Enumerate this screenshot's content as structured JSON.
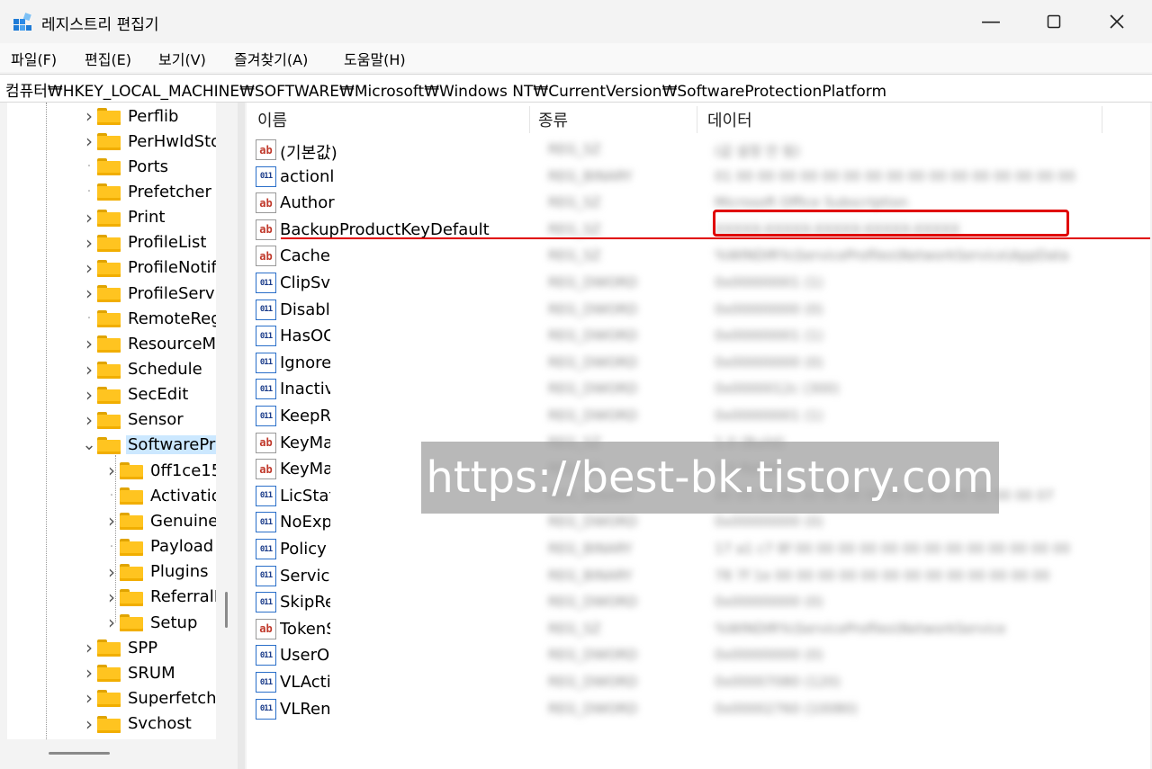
{
  "window": {
    "title": "레지스트리 편집기"
  },
  "menu": [
    "파일(F)",
    "편집(E)",
    "보기(V)",
    "즐겨찾기(A)",
    "도움말(H)"
  ],
  "address": "컴퓨터₩HKEY_LOCAL_MACHINE₩SOFTWARE₩Microsoft₩Windows NT₩CurrentVersion₩SoftwareProtectionPlatform",
  "tree": [
    {
      "label": "Perflib",
      "level": 0,
      "expand": "collapsed"
    },
    {
      "label": "PerHwIdSto",
      "level": 0,
      "expand": "collapsed"
    },
    {
      "label": "Ports",
      "level": 0,
      "expand": "none"
    },
    {
      "label": "Prefetcher",
      "level": 0,
      "expand": "none"
    },
    {
      "label": "Print",
      "level": 0,
      "expand": "collapsed"
    },
    {
      "label": "ProfileList",
      "level": 0,
      "expand": "collapsed"
    },
    {
      "label": "ProfileNotif",
      "level": 0,
      "expand": "collapsed"
    },
    {
      "label": "ProfileServi",
      "level": 0,
      "expand": "collapsed"
    },
    {
      "label": "RemoteReg",
      "level": 0,
      "expand": "none"
    },
    {
      "label": "ResourceM",
      "level": 0,
      "expand": "collapsed"
    },
    {
      "label": "Schedule",
      "level": 0,
      "expand": "collapsed"
    },
    {
      "label": "SecEdit",
      "level": 0,
      "expand": "collapsed"
    },
    {
      "label": "Sensor",
      "level": 0,
      "expand": "collapsed"
    },
    {
      "label": "SoftwarePr",
      "level": 0,
      "expand": "expanded",
      "selected": true
    },
    {
      "label": "0ff1ce15",
      "level": 1,
      "expand": "collapsed"
    },
    {
      "label": "Activatio",
      "level": 1,
      "expand": "none"
    },
    {
      "label": "Genuine",
      "level": 1,
      "expand": "collapsed"
    },
    {
      "label": "Payload",
      "level": 1,
      "expand": "none"
    },
    {
      "label": "Plugins",
      "level": 1,
      "expand": "collapsed"
    },
    {
      "label": "ReferralD",
      "level": 1,
      "expand": "collapsed"
    },
    {
      "label": "Setup",
      "level": 1,
      "expand": "collapsed"
    },
    {
      "label": "SPP",
      "level": 0,
      "expand": "collapsed"
    },
    {
      "label": "SRUM",
      "level": 0,
      "expand": "collapsed"
    },
    {
      "label": "Superfetch",
      "level": 0,
      "expand": "collapsed"
    },
    {
      "label": "Svchost",
      "level": 0,
      "expand": "collapsed"
    }
  ],
  "columns": {
    "name": "이름",
    "type": "종류",
    "data": "데이터"
  },
  "values": [
    {
      "name": "(기본값)",
      "kind": "sz",
      "type": "REG_SZ",
      "data": "(값 설정 안 됨)"
    },
    {
      "name": "actionli",
      "kind": "dword",
      "type": "REG_BINARY",
      "data": "01 00 00 00 00 00 00 00 00 00 00 00 00 00 00 00 00"
    },
    {
      "name": "Author",
      "kind": "sz",
      "type": "REG_SZ",
      "data": "Microsoft Office Subscription"
    },
    {
      "name": "BackupProductKeyDefault",
      "kind": "sz",
      "type": "REG_SZ",
      "data": "XXXXX-XXXXX-XXXXX-XXXXX-XXXXX"
    },
    {
      "name": "Cache",
      "kind": "sz",
      "type": "REG_SZ",
      "data": "%WINDIR%\\ServiceProfiles\\NetworkService\\AppData"
    },
    {
      "name": "ClipSv",
      "kind": "dword",
      "type": "REG_DWORD",
      "data": "0x00000001 (1)"
    },
    {
      "name": "Disable",
      "kind": "dword",
      "type": "REG_DWORD",
      "data": "0x00000000 (0)"
    },
    {
      "name": "HasOC",
      "kind": "dword",
      "type": "REG_DWORD",
      "data": "0x00000001 (1)"
    },
    {
      "name": "Ignore",
      "kind": "dword",
      "type": "REG_DWORD",
      "data": "0x00000000 (0)"
    },
    {
      "name": "Inactiv",
      "kind": "dword",
      "type": "REG_DWORD",
      "data": "0x0000012c (300)"
    },
    {
      "name": "KeepR",
      "kind": "dword",
      "type": "REG_DWORD",
      "data": "0x00000001 (1)"
    },
    {
      "name": "KeyMa",
      "kind": "sz",
      "type": "REG_SZ",
      "data": "1.0 (Build)"
    },
    {
      "name": "KeyMa",
      "kind": "sz",
      "type": "REG_SZ",
      "data": "3.0 Retail"
    },
    {
      "name": "LicStat",
      "kind": "dword",
      "type": "REG_BINARY",
      "data": "00 00 00 00 00 00 00 00 00 00 00 00 00 00 00 07"
    },
    {
      "name": "NoExp",
      "kind": "dword",
      "type": "REG_DWORD",
      "data": "0x00000000 (0)"
    },
    {
      "name": "Policy",
      "kind": "dword",
      "type": "REG_BINARY",
      "data": "17 a1 c7 8f 00 00 00 00 00 00 00 00 00 00 00 00 00"
    },
    {
      "name": "Service",
      "kind": "dword",
      "type": "REG_BINARY",
      "data": "78 7f 1e 00 00 00 00 00 00 00 00 00 00 00 00 00"
    },
    {
      "name": "SkipRe",
      "kind": "dword",
      "type": "REG_DWORD",
      "data": "0x00000000 (0)"
    },
    {
      "name": "TokenS",
      "kind": "sz",
      "type": "REG_SZ",
      "data": "%WINDIR%\\ServiceProfiles\\NetworkService"
    },
    {
      "name": "UserOp",
      "kind": "dword",
      "type": "REG_DWORD",
      "data": "0x00000000 (0)"
    },
    {
      "name": "VLActi",
      "kind": "dword",
      "type": "REG_DWORD",
      "data": "0x00007080 (120)"
    },
    {
      "name": "VLRen",
      "kind": "dword",
      "type": "REG_DWORD",
      "data": "0x00002760 (10080)"
    }
  ],
  "watermark": "https://best-bk.tistory.com",
  "colors": {
    "highlight": "#e00000",
    "folder": "#ffc420",
    "selection": "#cce8ff"
  }
}
